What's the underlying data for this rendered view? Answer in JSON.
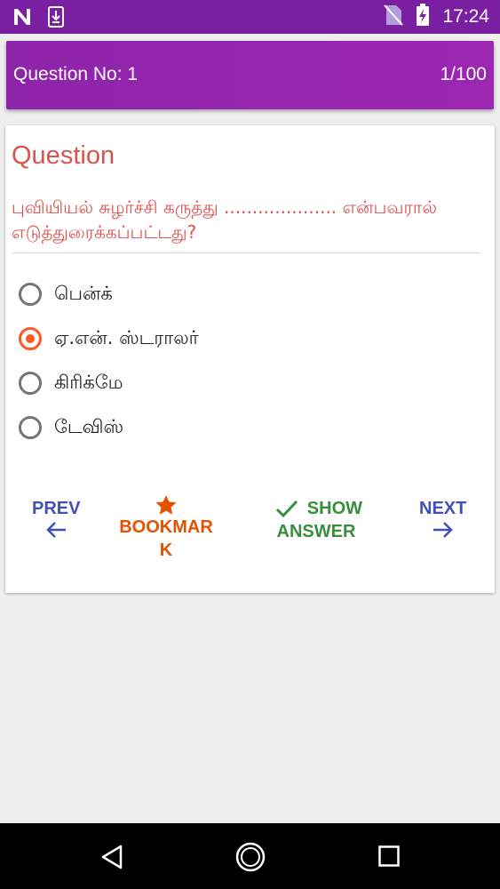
{
  "status_bar": {
    "time": "17:24",
    "icons": [
      "n-logo-icon",
      "download-icon",
      "no-sim-icon",
      "battery-charging-icon"
    ]
  },
  "header": {
    "question_label": "Question No: 1",
    "question_counter": "1/100"
  },
  "question": {
    "heading": "Question",
    "text": "புவியியல் சுழர்ச்சி கருத்து .................... என்பவரால் எடுத்துரைக்கப்பட்டது?",
    "options": [
      {
        "label": "பென்க்",
        "selected": false
      },
      {
        "label": "ஏ.என். ஸ்டராலர்",
        "selected": true
      },
      {
        "label": "கிரிக்மே",
        "selected": false
      },
      {
        "label": "டேவிஸ்",
        "selected": false
      }
    ]
  },
  "actions": {
    "prev_label": "PREV",
    "bookmark_label_1": "BOOKMAR",
    "bookmark_label_2": "K",
    "show_label_1": "SHOW",
    "show_label_2": "ANSWER",
    "next_label": "NEXT"
  },
  "colors": {
    "primary": "#8e24aa",
    "question_text": "#d9534f",
    "accent": "#ff5722",
    "nav_blue": "#3f51b5",
    "bookmark": "#e65100",
    "show_green": "#388e3c"
  },
  "nav_bar": {
    "icons": [
      "back-icon",
      "home-icon",
      "recents-icon"
    ]
  }
}
